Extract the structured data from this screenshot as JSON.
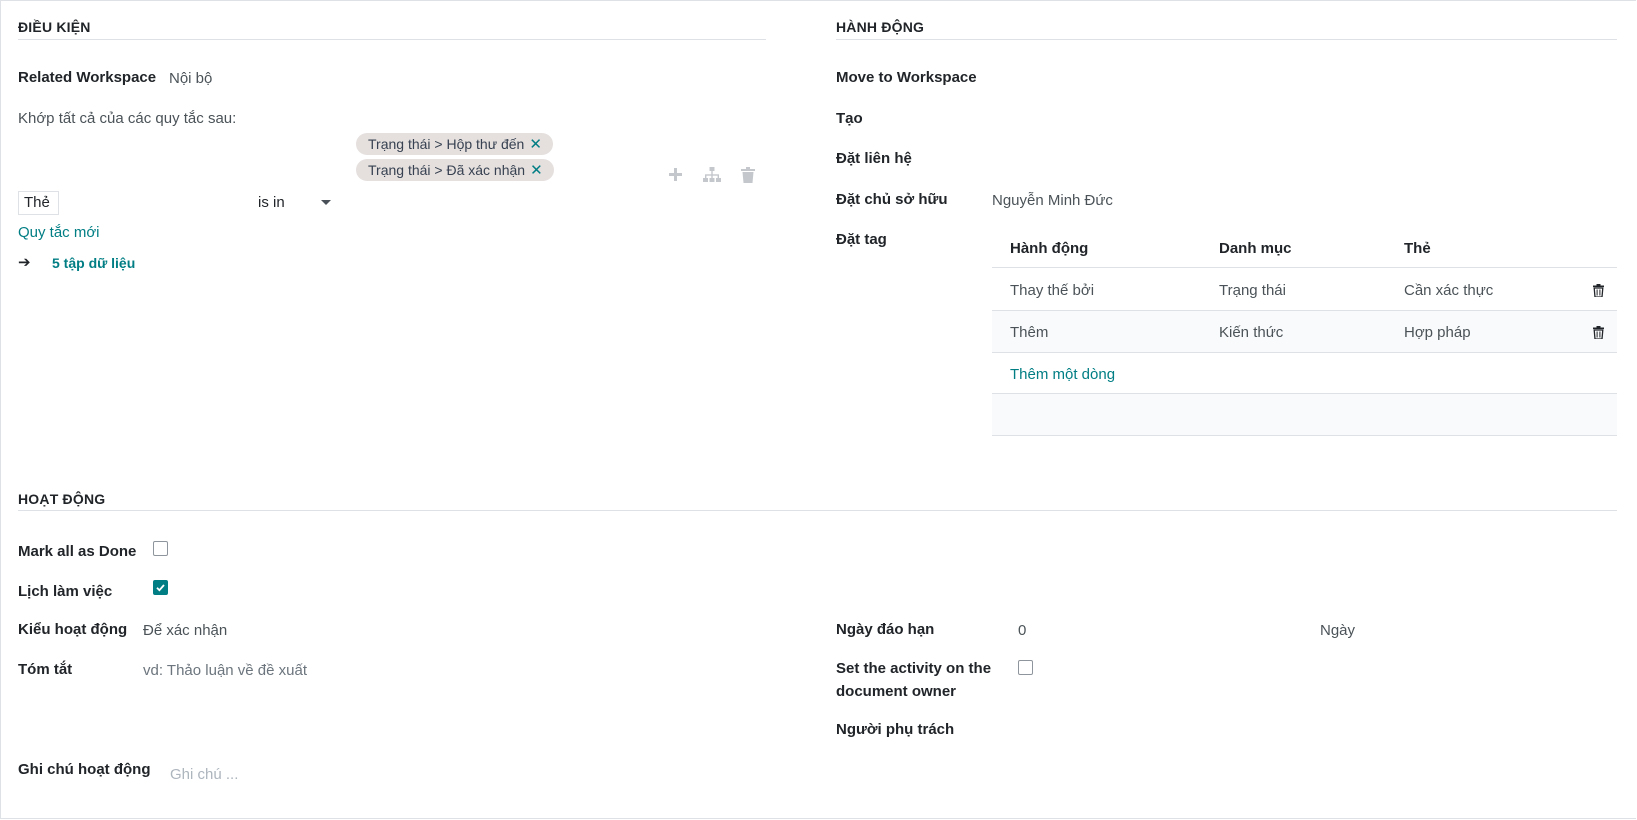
{
  "conditions": {
    "title": "ĐIỀU KIỆN",
    "related_workspace_label": "Related Workspace",
    "related_workspace_value": "Nội bộ",
    "match_text": "Khớp tất cả của các quy tắc sau:",
    "tags": [
      {
        "label": "Trạng thái > Hộp thư đến",
        "remove": "✕"
      },
      {
        "label": "Trạng thái > Đã xác nhận",
        "remove": "✕"
      }
    ],
    "rule_field": "Thẻ",
    "rule_operator": "is in",
    "new_rule": "Quy tắc mới",
    "records_arrow": "➔",
    "records_link": "5 tập dữ liệu"
  },
  "actions": {
    "title": "HÀNH ĐỘNG",
    "move_to_workspace_label": "Move to Workspace",
    "create_label": "Tạo",
    "set_contact_label": "Đặt liên hệ",
    "set_owner_label": "Đặt chủ sở hữu",
    "set_owner_value": "Nguyễn Minh Đức",
    "set_tag_label": "Đặt tag",
    "tag_table": {
      "columns": [
        "Hành động",
        "Danh mục",
        "Thẻ"
      ],
      "rows": [
        {
          "action": "Thay thế bởi",
          "category": "Trạng thái",
          "tag": "Cần xác thực"
        },
        {
          "action": "Thêm",
          "category": "Kiến thức",
          "tag": "Hợp pháp"
        }
      ],
      "add_line": "Thêm một dòng"
    }
  },
  "activity": {
    "title": "HOẠT ĐỘNG",
    "mark_done_label": "Mark all as Done",
    "mark_done_checked": false,
    "schedule_label": "Lịch làm việc",
    "schedule_checked": true,
    "activity_type_label": "Kiểu hoạt động",
    "activity_type_value": "Để xác nhận",
    "summary_label": "Tóm tắt",
    "summary_placeholder": "vd: Thảo luận về đề xuất",
    "note_label": "Ghi chú hoạt động",
    "note_placeholder": "Ghi chú ...",
    "due_date_label": "Ngày đáo hạn",
    "due_date_value": "0",
    "due_date_unit": "Ngày",
    "owner_activity_label_line1": "Set the activity on the",
    "owner_activity_label_line2": "document owner",
    "owner_activity_checked": false,
    "responsible_label": "Người phụ trách"
  },
  "colors": {
    "accent": "#017e84",
    "chip_bg": "#e5e0de",
    "border": "#dee2e6"
  }
}
